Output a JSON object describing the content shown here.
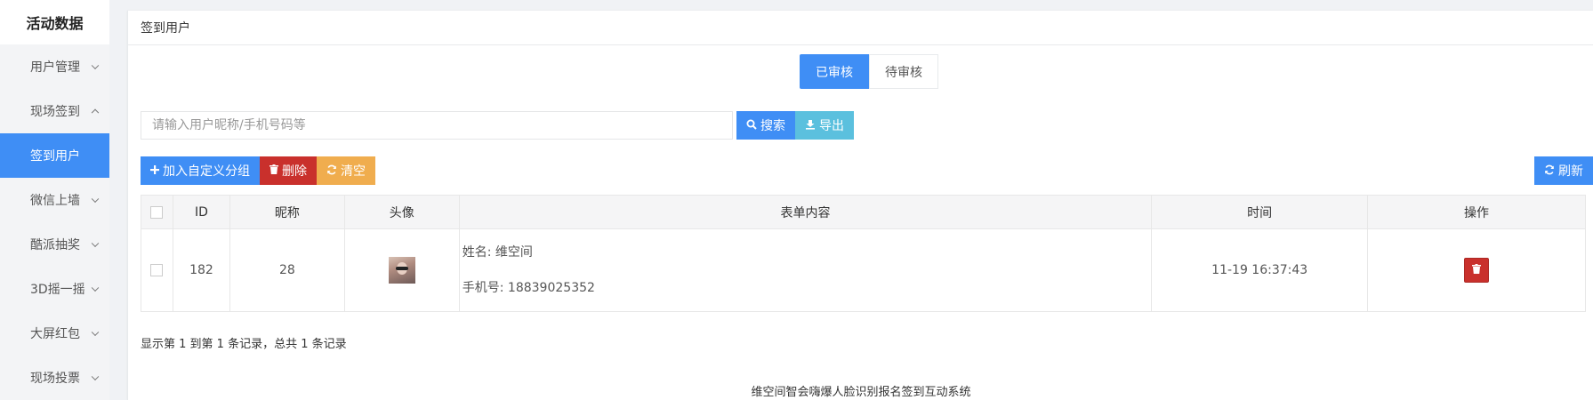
{
  "brand": "活动数据",
  "sidebar": {
    "items": [
      {
        "label": "用户管理",
        "state": "collapsed"
      },
      {
        "label": "现场签到",
        "state": "expanded"
      },
      {
        "label": "签到用户",
        "state": "active"
      },
      {
        "label": "微信上墙",
        "state": "collapsed"
      },
      {
        "label": "酷派抽奖",
        "state": "collapsed"
      },
      {
        "label": "3D摇一摇",
        "state": "collapsed"
      },
      {
        "label": "大屏红包",
        "state": "collapsed"
      },
      {
        "label": "现场投票",
        "state": "collapsed"
      }
    ]
  },
  "panel": {
    "title": "签到用户"
  },
  "tabs": [
    {
      "label": "已审核",
      "active": true
    },
    {
      "label": "待审核",
      "active": false
    }
  ],
  "search": {
    "placeholder": "请输入用户昵称/手机号码等",
    "search_label": "搜索",
    "export_label": "导出"
  },
  "toolbar": {
    "add_group_label": "加入自定义分组",
    "delete_label": "删除",
    "clear_label": "清空",
    "refresh_label": "刷新"
  },
  "table": {
    "headers": [
      "ID",
      "昵称",
      "头像",
      "表单内容",
      "时间",
      "操作"
    ],
    "rows": [
      {
        "id": "182",
        "nickname": "28",
        "form_name": "姓名: 维空间",
        "form_phone": "手机号: 18839025352",
        "time": "11-19 16:37:43"
      }
    ]
  },
  "summary": "显示第 1 到第 1 条记录，总共 1 条记录",
  "footer": "维空间智会嗨爆人脸识别报名签到互动系统",
  "colors": {
    "primary": "#3f8ef5",
    "info": "#5bc0de",
    "danger": "#c9302c",
    "warning": "#f0ad4e"
  }
}
